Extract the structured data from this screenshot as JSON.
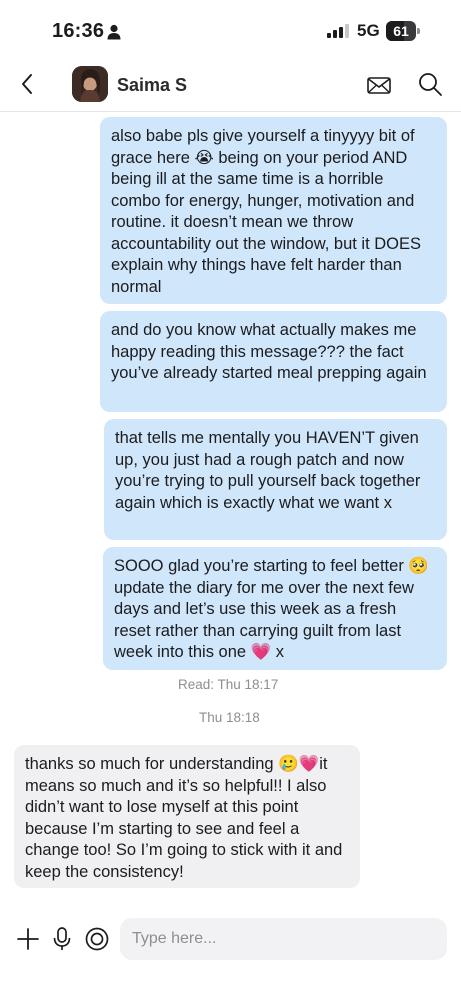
{
  "status_bar": {
    "time": "16:36",
    "network": "5G",
    "battery_level": "61",
    "battery_fraction": 0.61
  },
  "header": {
    "contact_name": "Saima S",
    "icons": {
      "back": "chevron-left-icon",
      "mail": "envelope-icon",
      "search": "search-icon"
    }
  },
  "messages": [
    {
      "direction": "outgoing",
      "text": "also babe pls give yourself a tinyyyy bit of grace here 😭 being on your period AND being ill at the same time is a horrible combo for energy, hunger, motivation and routine. it doesn’t mean we throw accountability out the window, but it DOES explain why things have felt harder than normal"
    },
    {
      "direction": "outgoing",
      "text": "and do you know what actually makes me happy reading this message??? the fact you’ve already started meal prepping again"
    },
    {
      "direction": "outgoing",
      "text": "that tells me mentally you HAVEN’T given up, you just had a rough patch and now you’re trying to pull yourself back together again which is exactly what we want x"
    },
    {
      "direction": "outgoing",
      "text": "SOOO glad you’re starting to feel better 🥺 update the diary for me over the next few days and let’s use this week as a fresh reset rather than carrying guilt from last week into this one 💗 x"
    },
    {
      "direction": "incoming",
      "text": "thanks so much for understanding 🥲💗it means so much and it’s so helpful!! I also didn’t want to lose myself at this point because I’m starting to see and feel a change too! So I’m going to stick with it and keep the consistency!"
    }
  ],
  "read_receipt": "Read: Thu 18:17",
  "timestamp_separator": "Thu 18:18",
  "composer": {
    "placeholder": "Type here...",
    "icons": [
      "plus-icon",
      "microphone-icon",
      "camera-icon"
    ]
  },
  "colors": {
    "outgoing_bubble": "#cfe6fb",
    "incoming_bubble": "#f0f0f2",
    "meta_text": "#8e8e93"
  }
}
